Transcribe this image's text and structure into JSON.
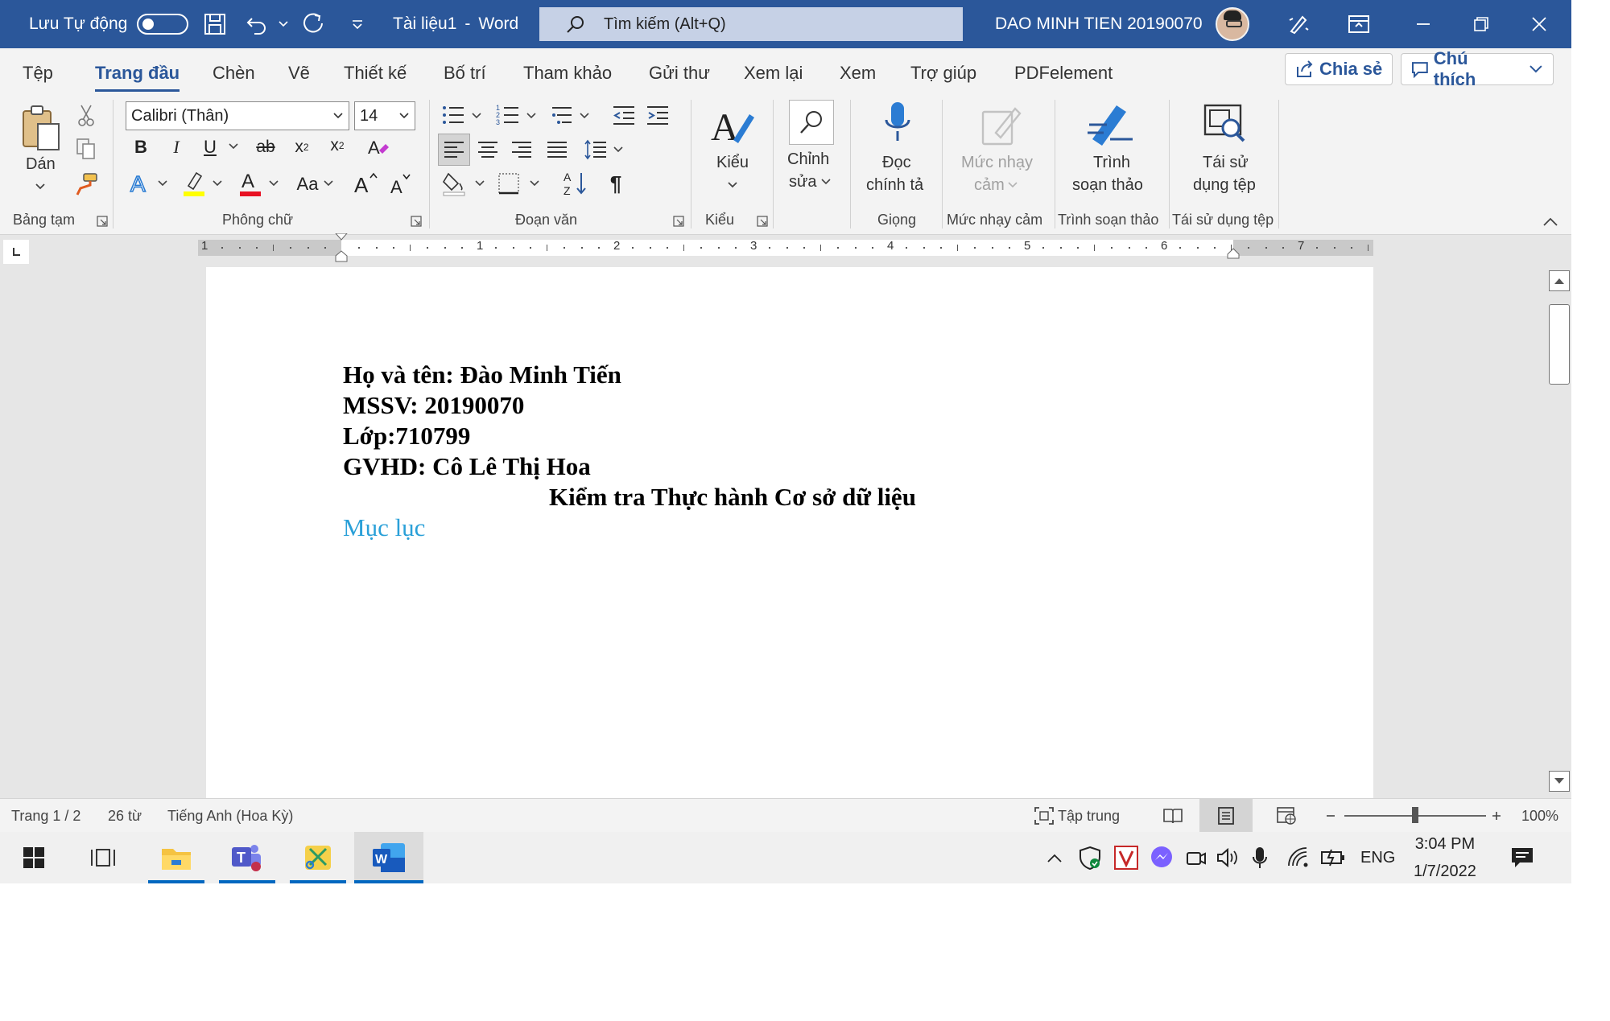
{
  "titlebar": {
    "autosave_label": "Lưu Tự động",
    "doc_title": "Tài liệu1",
    "separator": "-",
    "app_name": "Word",
    "search_placeholder": "Tìm kiếm (Alt+Q)",
    "user_name": "DAO MINH TIEN 20190070"
  },
  "menu": {
    "tabs": [
      "Tệp",
      "Trang đầu",
      "Chèn",
      "Vẽ",
      "Thiết kế",
      "Bố trí",
      "Tham khảo",
      "Gửi thư",
      "Xem lại",
      "Xem",
      "Trợ giúp",
      "PDFelement"
    ],
    "active_tab": "Trang đầu",
    "share_label": "Chia sẻ",
    "comment_label": "Chú thích"
  },
  "ribbon": {
    "clipboard": {
      "paste_label": "Dán",
      "group_label": "Bảng tạm"
    },
    "font": {
      "font_name": "Calibri (Thân)",
      "font_size": "14",
      "group_label": "Phông chữ",
      "change_case": "Aa"
    },
    "paragraph": {
      "group_label": "Đoạn văn"
    },
    "styles": {
      "label": "Kiểu",
      "group_label": "Kiểu"
    },
    "editing": {
      "label_line1": "Chỉnh",
      "label_line2": "sửa"
    },
    "voice": {
      "label_line1": "Đọc",
      "label_line2": "chính tả",
      "group_label": "Giọng"
    },
    "sensitivity": {
      "label_line1": "Mức nhạy",
      "label_line2": "cảm",
      "group_label": "Mức nhạy cảm"
    },
    "editor": {
      "label_line1": "Trình",
      "label_line2": "soạn thảo",
      "group_label": "Trình soạn thảo"
    },
    "reuse": {
      "label_line1": "Tái sử",
      "label_line2": "dụng tệp",
      "group_label": "Tái sử dụng tệp"
    }
  },
  "ruler": {
    "numbers": [
      "1",
      "1",
      "2",
      "3",
      "4",
      "5",
      "6",
      "7"
    ]
  },
  "document": {
    "lines": [
      "Họ và tên: Đào Minh Tiến",
      "MSSV: 20190070",
      "Lớp:710799",
      "GVHD: Cô Lê Thị Hoa"
    ],
    "title": "Kiểm tra Thực hành Cơ sở dữ liệu",
    "toc_heading": "Mục lục"
  },
  "statusbar": {
    "page": "Trang 1 / 2",
    "words": "26 từ",
    "language": "Tiếng Anh (Hoa Kỳ)",
    "focus": "Tập trung",
    "zoom": "100%",
    "zoom_level": 0.5
  },
  "taskbar": {
    "language": "ENG",
    "time": "3:04 PM",
    "date": "1/7/2022"
  },
  "colors": {
    "word_blue": "#2b579a",
    "toc_blue": "#2aa0d8",
    "taskbar_accent": "#0067c0"
  }
}
